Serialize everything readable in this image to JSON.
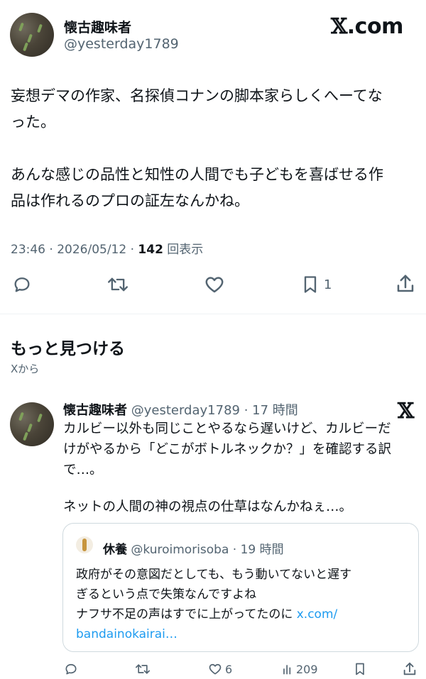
{
  "header": {
    "author_name": "懐古趣味者",
    "author_handle": "@yesterday1789",
    "logo_x": "𝕏",
    "logo_text": ".com"
  },
  "post": {
    "text_lines": [
      "妄想デマの作家、名探偵コナンの脚本家らしくへーてな",
      "った。",
      "",
      "あんな感じの品性と知性の人間でも子どもを喜ばせる作",
      "品は作れるのプロの証左なんかね。"
    ],
    "timestamp": "23:46 · 2026/05/12 · ",
    "views_count": "142",
    "views_label": " 回表示"
  },
  "actions": {
    "reply_icon": "reply-icon",
    "repost_icon": "repost-icon",
    "like_icon": "heart-icon",
    "bookmark_icon": "bookmark-icon",
    "bookmark_count": "1",
    "share_icon": "share-icon"
  },
  "discover": {
    "title": "もっと見つける",
    "subtitle": "Xから"
  },
  "related_post": {
    "author_name": "懐古趣味者",
    "author_handle": "@yesterday1789 · 17 時間",
    "x_mark": "𝕏",
    "text_lines": [
      "カルビー以外も同じことやるなら遅いけど、カルビーだ",
      "けがやるから「どこがボトルネックか？」を確認する訳",
      "で…。",
      "",
      "ネットの人間の神の視点の仕草はなんかねぇ…。"
    ],
    "quote": {
      "author_name": "休養",
      "author_handle": "@kuroimorisoba · 19 時間",
      "text_lines": [
        "政府がその意図だとしても、もう動いてないと遅す",
        "ぎるという点で失策なんですよね",
        "ナフサ不足の声はすでに上がってたのに "
      ],
      "link_part1": "x.com/",
      "link_part2": "bandainokairai…"
    },
    "actions": {
      "like_count": "6",
      "views_count": "209"
    }
  },
  "colors": {
    "text": "#0f1419",
    "muted": "#536471",
    "link": "#1d9bf0",
    "border": "#cfd9de"
  }
}
